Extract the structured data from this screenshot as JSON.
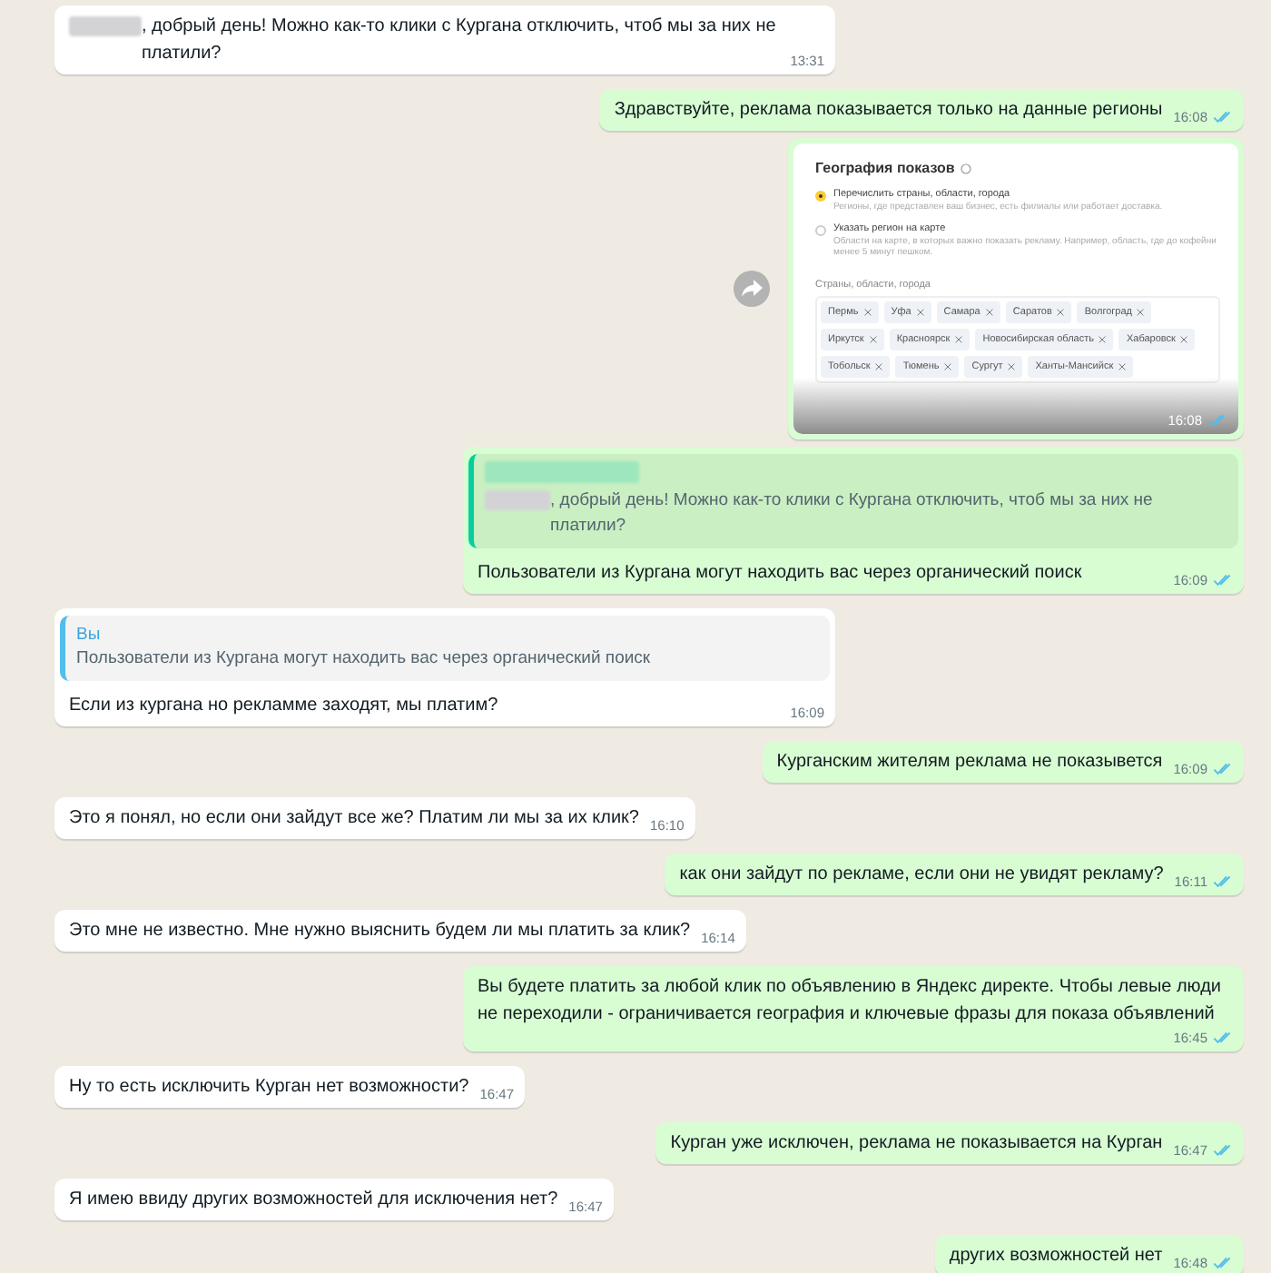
{
  "messages": [
    {
      "kind": "text",
      "outgoing": false,
      "redacted": true,
      "text": ", добрый день! Можно как-то клики с Кургана отключить, чтоб мы за них не платили?",
      "time": "13:31"
    },
    {
      "kind": "text",
      "outgoing": true,
      "text": "Здравствуйте, реклама показывается только на данные регионы",
      "time": "16:08",
      "read": true
    },
    {
      "kind": "image",
      "outgoing": true,
      "time": "16:08",
      "read": true,
      "screenshot": {
        "title": "География показов",
        "options": [
          {
            "label": "Перечислить страны, области, города",
            "hint": "Регионы, где представлен ваш бизнес, есть филиалы или работает доставка.",
            "selected": true
          },
          {
            "label": "Указать регион на карте",
            "hint": "Области на карте, в которых важно показать рекламу. Например, область, где до кофейни менее 5 минут пешком.",
            "selected": false
          }
        ],
        "field_label": "Страны, области, города",
        "tags": [
          "Пермь",
          "Уфа",
          "Самара",
          "Саратов",
          "Волгоград",
          "Иркутск",
          "Красноярск",
          "Новосибирская область",
          "Хабаровск",
          "Тобольск",
          "Тюмень",
          "Сургут",
          "Ханты-Мансийск"
        ]
      }
    },
    {
      "kind": "reply",
      "outgoing": true,
      "quote": {
        "sender_hidden": true,
        "redacted": true,
        "text": ", добрый день! Можно как-то клики с Кургана отключить, чтоб мы за них не платили?"
      },
      "text": "Пользователи из Кургана могут находить вас через органический поиск",
      "time": "16:09",
      "read": true
    },
    {
      "kind": "reply",
      "outgoing": false,
      "quote": {
        "sender": "Вы",
        "text": "Пользователи из Кургана могут находить вас через органический поиск"
      },
      "text": "Если из кургана но рекламме заходят, мы платим?",
      "time": "16:09"
    },
    {
      "kind": "text",
      "outgoing": true,
      "text": "Курганским жителям реклама не показывется",
      "time": "16:09",
      "read": true
    },
    {
      "kind": "text",
      "outgoing": false,
      "text": "Это я понял, но если они зайдут все же? Платим ли мы за их клик?",
      "time": "16:10"
    },
    {
      "kind": "text",
      "outgoing": true,
      "text": "как они зайдут по рекламе, если они не увидят рекламу?",
      "time": "16:11",
      "read": true
    },
    {
      "kind": "text",
      "outgoing": false,
      "text": "Это мне не известно. Мне нужно выяснить будем ли мы платить за клик?",
      "time": "16:14"
    },
    {
      "kind": "text",
      "outgoing": true,
      "text": "Вы будете платить за любой клик по объявлению в Яндекс директе. Чтобы левые люди не переходили - ограничивается география и ключевые фразы для показа объявлений",
      "time": "16:45",
      "read": true
    },
    {
      "kind": "text",
      "outgoing": false,
      "text": "Ну то есть исключить Курган нет возможности?",
      "time": "16:47"
    },
    {
      "kind": "text",
      "outgoing": true,
      "text": "Курган уже исключен, реклама не показывается на Курган",
      "time": "16:47",
      "read": true
    },
    {
      "kind": "text",
      "outgoing": false,
      "text": "Я имею ввиду других возможностей для исключения нет?",
      "time": "16:47"
    },
    {
      "kind": "text",
      "outgoing": true,
      "text": "других возможностей нет",
      "time": "16:48",
      "read": true
    }
  ]
}
